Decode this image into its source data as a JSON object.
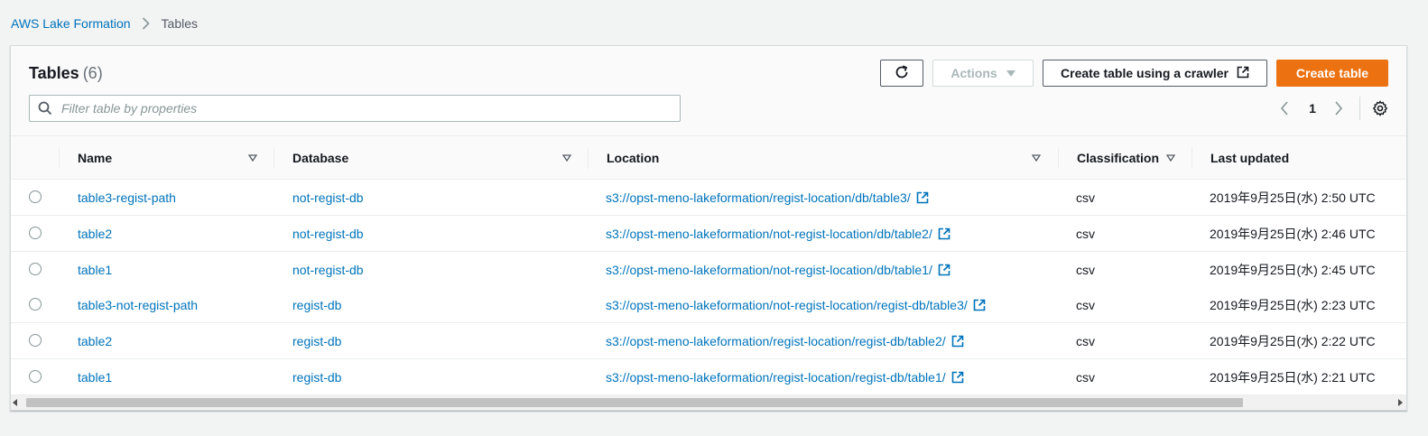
{
  "breadcrumb": {
    "root": "AWS Lake Formation",
    "current": "Tables"
  },
  "header": {
    "title": "Tables",
    "count": "(6)",
    "actions_label": "Actions",
    "crawler_label": "Create table using a crawler",
    "create_label": "Create table",
    "filter_placeholder": "Filter table by properties",
    "page": "1"
  },
  "icons": {
    "refresh": "refresh-icon",
    "search": "search-icon",
    "external": "external-link-icon",
    "settings": "gear-icon",
    "sort": "sort-caret-icon"
  },
  "colors": {
    "accent": "#ec7211",
    "link": "#0073bb",
    "text": "#16191f"
  },
  "table": {
    "columns": [
      "Name",
      "Database",
      "Location",
      "Classification",
      "Last updated"
    ],
    "rows": [
      {
        "name": "table3-regist-path",
        "database": "not-regist-db",
        "location": "s3://opst-meno-lakeformation/regist-location/db/table3/",
        "classification": "csv",
        "updated": "2019年9月25日(水) 2:50 UTC"
      },
      {
        "name": "table2",
        "database": "not-regist-db",
        "location": "s3://opst-meno-lakeformation/not-regist-location/db/table2/",
        "classification": "csv",
        "updated": "2019年9月25日(水) 2:46 UTC"
      },
      {
        "name": "table1",
        "database": "not-regist-db",
        "location": "s3://opst-meno-lakeformation/not-regist-location/db/table1/",
        "classification": "csv",
        "updated": "2019年9月25日(水) 2:45 UTC"
      },
      {
        "name": "table3-not-regist-path",
        "database": "regist-db",
        "location": "s3://opst-meno-lakeformation/not-regist-location/regist-db/table3/",
        "classification": "csv",
        "updated": "2019年9月25日(水) 2:23 UTC"
      },
      {
        "name": "table2",
        "database": "regist-db",
        "location": "s3://opst-meno-lakeformation/regist-location/regist-db/table2/",
        "classification": "csv",
        "updated": "2019年9月25日(水) 2:22 UTC"
      },
      {
        "name": "table1",
        "database": "regist-db",
        "location": "s3://opst-meno-lakeformation/regist-location/regist-db/table1/",
        "classification": "csv",
        "updated": "2019年9月25日(水) 2:21 UTC"
      }
    ]
  }
}
